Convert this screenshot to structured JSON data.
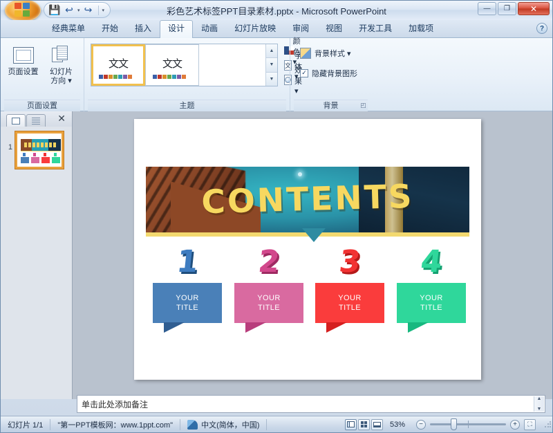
{
  "window": {
    "title": "彩色艺术标签PPT目录素材.pptx  -  Microsoft PowerPoint",
    "minimize_label": "—",
    "restore_label": "❐",
    "close_label": "✕"
  },
  "quick_access": {
    "save_label": "💾",
    "undo_label": "↩",
    "undo_caret": "▾",
    "redo_label": "↪",
    "customize_caret": "▾"
  },
  "tabs": [
    {
      "label": "经典菜单",
      "active": false
    },
    {
      "label": "开始",
      "active": false
    },
    {
      "label": "插入",
      "active": false
    },
    {
      "label": "设计",
      "active": true
    },
    {
      "label": "动画",
      "active": false
    },
    {
      "label": "幻灯片放映",
      "active": false
    },
    {
      "label": "审阅",
      "active": false
    },
    {
      "label": "视图",
      "active": false
    },
    {
      "label": "开发工具",
      "active": false
    },
    {
      "label": "加载项",
      "active": false
    }
  ],
  "help_button": "?",
  "ribbon": {
    "groups": [
      {
        "title": "页面设置",
        "buttons": [
          {
            "label": "页面设置",
            "icon": "page-setup-icon"
          },
          {
            "label": "幻灯片\n方向 ▾",
            "icon": "slide-orientation-icon"
          }
        ]
      },
      {
        "title": "主题",
        "gallery": {
          "thumbs": [
            {
              "text": "文文",
              "selected": true,
              "swatches": [
                "#3a5fa8",
                "#c0392b",
                "#d98f2a",
                "#6aa84f",
                "#2e9bb5",
                "#7a5ca8",
                "#e07b39"
              ]
            },
            {
              "text": "文文",
              "selected": false,
              "swatches": [
                "#3a5fa8",
                "#c0392b",
                "#d98f2a",
                "#6aa84f",
                "#2e9bb5",
                "#7a5ca8",
                "#e07b39"
              ]
            }
          ],
          "scroll_up": "▲",
          "scroll_down": "▼",
          "scroll_more": "▼"
        },
        "small_buttons": [
          {
            "label": "颜色 ▾",
            "icon": "theme-colors-icon"
          },
          {
            "label": "字体 ▾",
            "icon": "theme-fonts-icon"
          },
          {
            "label": "效果 ▾",
            "icon": "theme-effects-icon"
          }
        ]
      },
      {
        "title": "背景",
        "background_styles_label": "背景样式 ▾",
        "hide_graphics_label": "隐藏背景图形",
        "hide_graphics_checked": true,
        "dialog_launcher": "◰"
      }
    ]
  },
  "left_pane": {
    "tab_slides": "slides-tab",
    "tab_outline": "outline-tab",
    "close_label": "✕",
    "slides": [
      {
        "number": "1"
      }
    ]
  },
  "slide": {
    "banner_title": "CONTENTS",
    "items": [
      {
        "number": "1",
        "title_line1": "YOUR",
        "title_line2": "TITLE",
        "color": "#4a80b8",
        "dark": "#2f5d91",
        "num_color": "#3e7cc0"
      },
      {
        "number": "2",
        "title_line1": "YOUR",
        "title_line2": "TITLE",
        "color": "#d96aa0",
        "dark": "#b83d7c",
        "num_color": "#d2488c"
      },
      {
        "number": "3",
        "title_line1": "YOUR",
        "title_line2": "TITLE",
        "color": "#fa3c3c",
        "dark": "#d51f1f",
        "num_color": "#f23232"
      },
      {
        "number": "4",
        "title_line1": "YOUR",
        "title_line2": "TITLE",
        "color": "#2fd79b",
        "dark": "#17b87f",
        "num_color": "#2fd79b"
      }
    ]
  },
  "notes": {
    "placeholder_text": "单击此处添加备注"
  },
  "status_bar": {
    "slide_counter": "幻灯片 1/1",
    "theme_name": "\"第一PPT模板网：www.1ppt.com\"",
    "language": "中文(简体，中国)",
    "view_normal": "normal-view",
    "view_sorter": "slide-sorter-view",
    "view_reading": "reading-view",
    "zoom_level": "53%",
    "zoom_out": "−",
    "zoom_in": "+",
    "fit_label": "⛶"
  }
}
